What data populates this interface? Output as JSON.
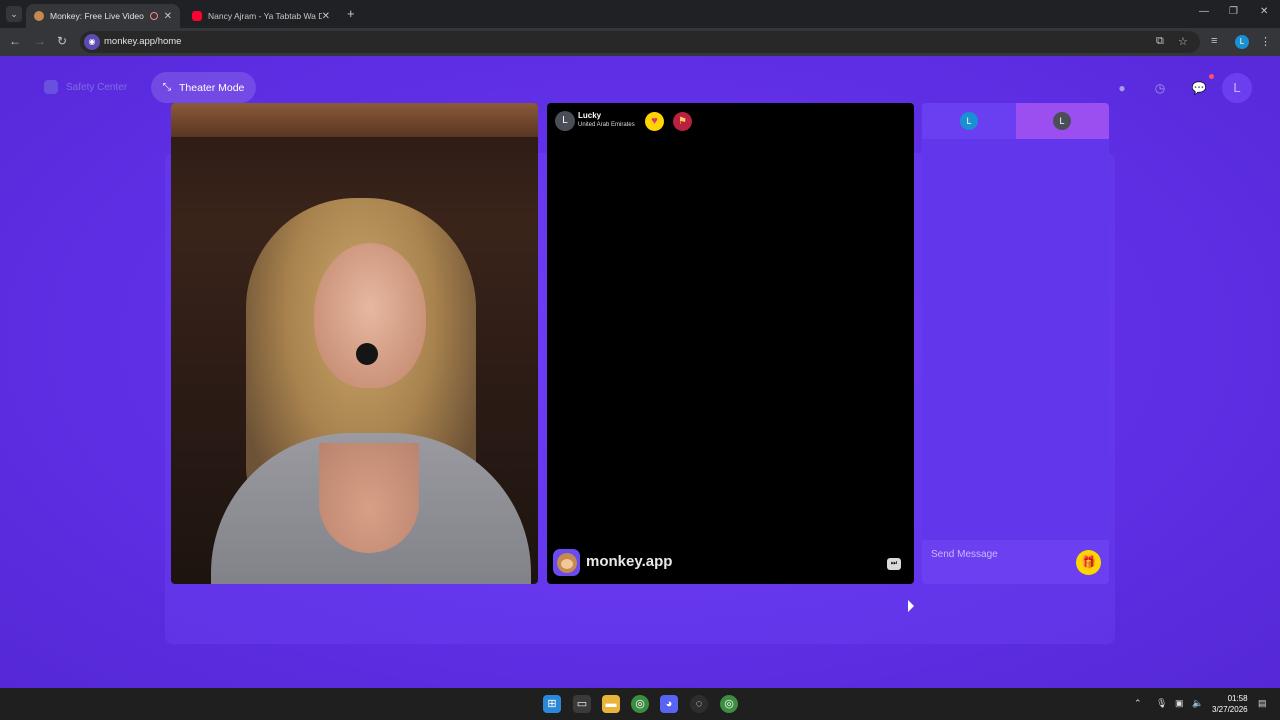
{
  "browser": {
    "tabs": [
      {
        "title": "Monkey: Free Live Video Ch",
        "active": true
      },
      {
        "title": "Nancy Ajram - Ya Tabtab Wa Da",
        "active": false
      }
    ],
    "url": "monkey.app/home",
    "profile_initial": "L"
  },
  "header": {
    "safety_center": "Safety Center",
    "theater_mode": "Theater Mode",
    "avatar_initial": "L"
  },
  "peer": {
    "avatar_initial": "L",
    "name": "Lucky",
    "country": "United Arab Emirates"
  },
  "watermark": {
    "text": "monkey.app"
  },
  "chat": {
    "tab_left_initial": "L",
    "tab_right_initial": "L",
    "placeholder": "Send Message"
  },
  "taskbar": {
    "time": "01:58",
    "date": "3/27/2026"
  },
  "colors": {
    "page_bg": "#5f2fe6",
    "chat_bg": "#6236ea",
    "chat_tab_active": "#9b4ff0",
    "gift": "#ffd500"
  }
}
